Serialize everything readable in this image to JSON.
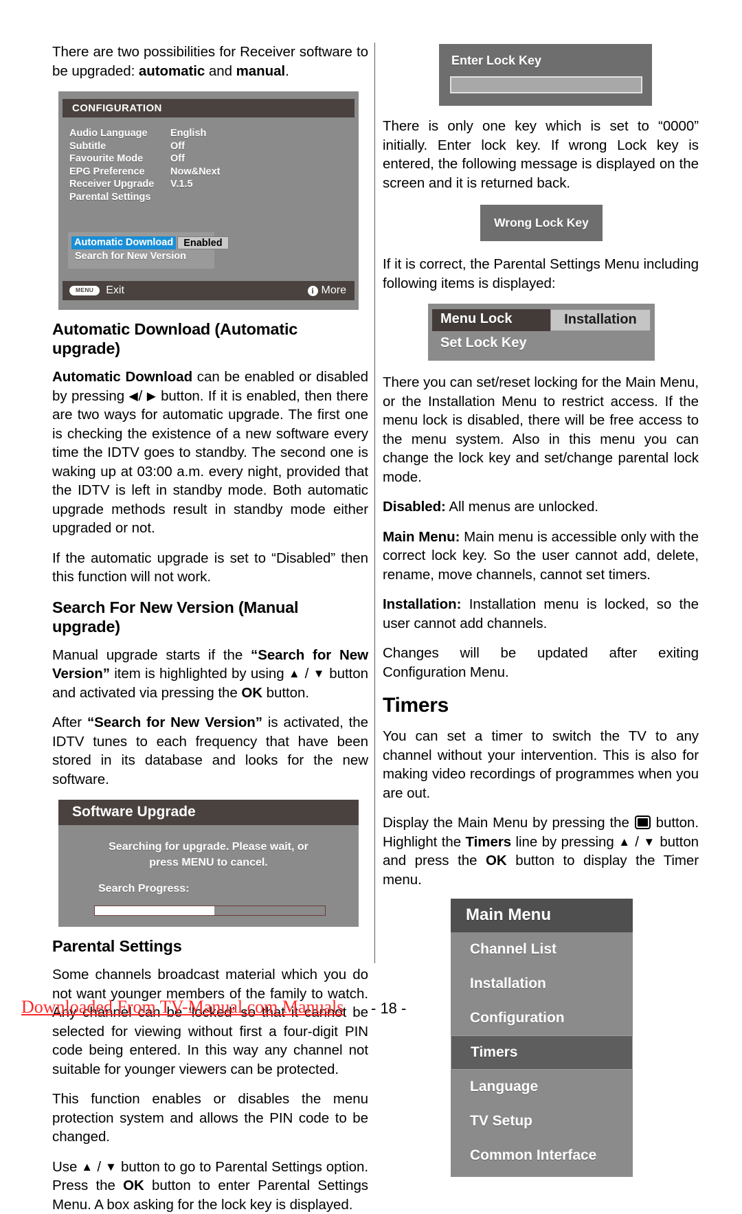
{
  "left": {
    "intro_p1_a": "There are two possibilities for Receiver software to be upgraded: ",
    "intro_p1_b": "automatic",
    "intro_p1_c": " and ",
    "intro_p1_d": "manual",
    "intro_p1_e": ".",
    "config_osd": {
      "title": "CONFIGURATION",
      "rows": [
        {
          "label": "Audio Language",
          "value": "English"
        },
        {
          "label": "Subtitle",
          "value": "Off"
        },
        {
          "label": "Favourite Mode",
          "value": "Off"
        },
        {
          "label": "EPG Preference",
          "value": "Now&Next"
        },
        {
          "label": "Receiver Upgrade",
          "value": "V.1.5"
        },
        {
          "label": "Parental Settings",
          "value": ""
        }
      ],
      "selected_label": "Automatic Download",
      "selected_value": "Enabled",
      "second_item": "Search for New Version",
      "footer_menu_pill": "MENU",
      "footer_exit": "Exit",
      "footer_info_glyph": "i",
      "footer_more": "More",
      "accent_highlight": "#1a8ed6",
      "title_bar_color": "#4a423f",
      "panel_color": "#8b8b8b"
    },
    "h_auto_download": "Automatic Download (Automatic upgrade)",
    "p_auto_1_bold": "Automatic Download",
    "p_auto_1_rest": " can be enabled or disabled by pressing ",
    "p_auto_1_rest2": " button. If it is enabled, then there are two ways for automatic upgrade. The first one is checking the existence of a new software every time the IDTV goes to standby. The second one is waking up at 03:00 a.m. every night, provided that the IDTV is left in standby mode. Both automatic upgrade methods result in standby mode either upgraded or not.",
    "p_auto_2": "If the automatic upgrade is set to “Disabled” then this function will not work.",
    "h_search_new": "Search For New Version (Manual upgrade)",
    "p_search_1_a": "Manual upgrade starts if the ",
    "p_search_1_b": "“Search for New Version”",
    "p_search_1_c": " item is highlighted by using ",
    "p_search_1_d": " button and activated via pressing the ",
    "p_search_1_e": "OK",
    "p_search_1_f": " button.",
    "p_search_2_a": "After ",
    "p_search_2_b": "“Search for New Version”",
    "p_search_2_c": " is activated, the IDTV tunes to each frequency that have been stored in its database and looks for the new software.",
    "software_upgrade_osd": {
      "title": "Software Upgrade",
      "message": "Searching for upgrade. Please wait, or press MENU to cancel.",
      "progress_label": "Search Progress:",
      "progress_percent": 52
    },
    "h_parental": "Parental Settings",
    "p_parental_1": "Some channels broadcast material which you do not want younger members of the family to watch. Any channel can be ‘locked’ so that it cannot be selected for viewing without first a four-digit PIN code being entered. In this way any channel not suitable for younger viewers can be protected.",
    "p_parental_2": "This function enables or disables the menu protection system and allows the PIN code to be changed.",
    "p_parental_3_a": "Use ",
    "p_parental_3_b": " button  to go to Parental Settings option. Press the ",
    "p_parental_3_c": "OK",
    "p_parental_3_d": " button to enter Parental Settings Menu. A box asking for the lock key is displayed."
  },
  "right": {
    "enter_lock_osd": {
      "title": "Enter Lock Key",
      "field_value": ""
    },
    "p_lock_1": "There is only one key which is set to “0000” initially. Enter lock key. If wrong Lock key is entered, the following message is displayed on the screen and it is returned back.",
    "wrong_lock_osd": {
      "title": "Wrong Lock Key"
    },
    "p_lock_2": "If it is correct, the Parental Settings Menu including following items is displayed:",
    "menu_lock_osd": {
      "key_label": "Menu Lock",
      "key_value": "Installation",
      "second_item": "Set Lock Key"
    },
    "p_lock_3": "There you can set/reset locking for the Main Menu, or the Installation Menu to restrict access. If the menu lock is disabled, there will be free access to the menu system. Also in this menu you can change the lock key and set/change parental lock mode.",
    "p_disabled_b": "Disabled:",
    "p_disabled_t": " All menus are unlocked.",
    "p_mainmenu_b": "Main Menu:",
    "p_mainmenu_t": " Main menu is accessible only with the correct lock key. So the user cannot add, delete, rename, move channels, cannot set timers.",
    "p_installation_b": "Installation:",
    "p_installation_t": " Installation menu is locked, so the user cannot add channels.",
    "p_changes": "Changes will be updated after exiting Configuration Menu.",
    "h_timers": "Timers",
    "p_timers_1": "You can set a timer to switch the TV to any channel without your intervention. This is also for making video recordings of programmes when you are out.",
    "p_timers_2_a": "Display the Main Menu by pressing the ",
    "p_timers_2_b": " button. Highlight the ",
    "p_timers_2_c": "Timers",
    "p_timers_2_d": " line by pressing ",
    "p_timers_2_e": " button and press the ",
    "p_timers_2_f": "OK",
    "p_timers_2_g": " button to display the Timer menu.",
    "main_menu_osd": {
      "title": "Main Menu",
      "items": [
        {
          "label": "Channel List",
          "selected": false
        },
        {
          "label": "Installation",
          "selected": false
        },
        {
          "label": "Configuration",
          "selected": false
        },
        {
          "label": "Timers",
          "selected": true
        },
        {
          "label": "Language",
          "selected": false
        },
        {
          "label": "TV Setup",
          "selected": false
        },
        {
          "label": "Common Interface",
          "selected": false
        }
      ]
    }
  },
  "footer": {
    "link_text": "Downloaded From TV-Manual.com Manuals",
    "page_number": "- 18 -",
    "link_color": "#ff2a2a"
  }
}
